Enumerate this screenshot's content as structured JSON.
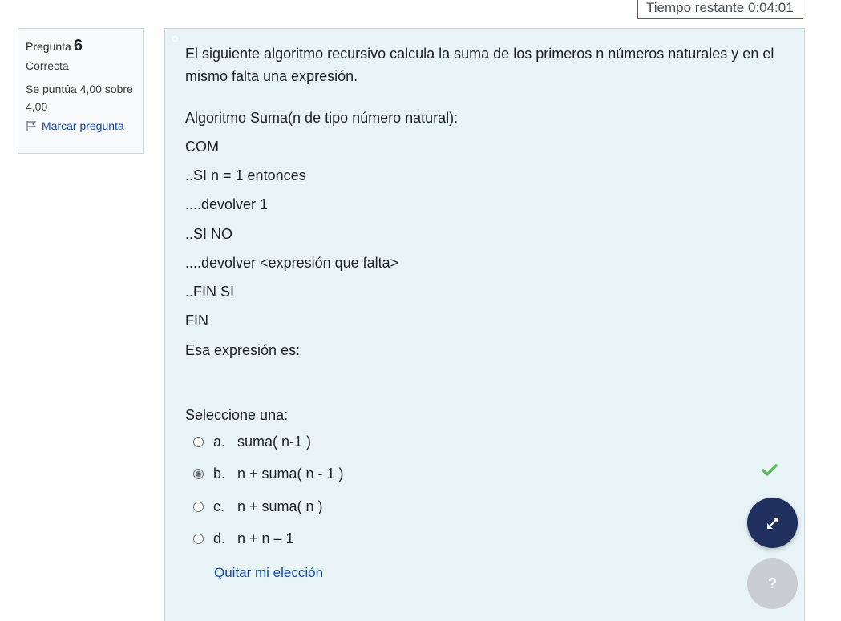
{
  "timer": {
    "label": "Tiempo restante",
    "value": "0:04:01"
  },
  "question_info": {
    "label": "Pregunta",
    "number": "6",
    "state": "Correcta",
    "grade": "Se puntúa 4,00 sobre 4,00",
    "flag_label": "Marcar pregunta"
  },
  "question": {
    "text": "El siguiente algoritmo recursivo calcula la suma de los primeros n números naturales y en el mismo falta una expresión.",
    "lines": [
      "Algoritmo Suma(n de tipo número natural):",
      "COM",
      "..SI n = 1 entonces",
      "....devolver 1",
      "..SI NO",
      "....devolver <expresión que falta>",
      "..FIN SI",
      "FIN",
      "Esa expresión es:"
    ],
    "prompt": "Seleccione una:",
    "options": [
      {
        "letter": "a.",
        "text": "suma( n-1 )",
        "selected": false
      },
      {
        "letter": "b.",
        "text": "n + suma( n - 1 )",
        "selected": true
      },
      {
        "letter": "c.",
        "text": "n + suma( n )",
        "selected": false
      },
      {
        "letter": "d.",
        "text": "n + n – 1",
        "selected": false
      }
    ],
    "clear_label": "Quitar mi elección"
  },
  "help_button": "?",
  "colors": {
    "accent": "#0f47ad",
    "correct": "#357a32",
    "panel": "#e7f3f5",
    "fab": "#1f2f5e"
  }
}
